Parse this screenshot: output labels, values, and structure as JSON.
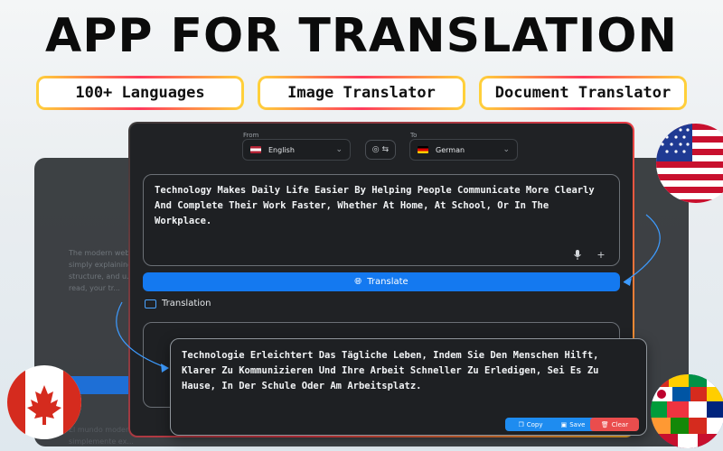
{
  "headline": "APP FOR TRANSLATION",
  "features": [
    "100+ Languages",
    "Image Translator",
    "Document Translator"
  ],
  "from_label": "From",
  "to_label": "To",
  "source_language": "English",
  "target_language": "German",
  "source_text": "Technology Makes Daily Life Easier By Helping People Communicate More Clearly And Complete Their Work Faster, Whether At Home, At School, Or In The Workplace.",
  "translate_label": "Translate",
  "translation_label": "Translation",
  "translated_text": "Technologie Erleichtert Das Tägliche Leben, Indem Sie Den Menschen Hilft, Klarer Zu Kommunizieren Und Ihre Arbeit Schneller Zu Erledigen, Sei Es Zu Hause, In Der Schule Oder Am Arbeitsplatz.",
  "actions": {
    "copy": "Copy",
    "save": "Save",
    "clear": "Clear"
  },
  "background_window": {
    "text_1": "The modern web... simply explaining... structure, and u... to read, your tr...",
    "text_2": "El mundo modern... simplemente ex..."
  },
  "colors": {
    "accent": "#1479f0",
    "copy": "#1e8cf0",
    "save": "#1e8cf0",
    "clear": "#ea4d4d"
  },
  "icons": [
    "globe-icon",
    "mic-icon",
    "plus-icon",
    "swap-icon",
    "chevron-down-icon",
    "copy-icon",
    "save-icon",
    "trash-icon"
  ]
}
